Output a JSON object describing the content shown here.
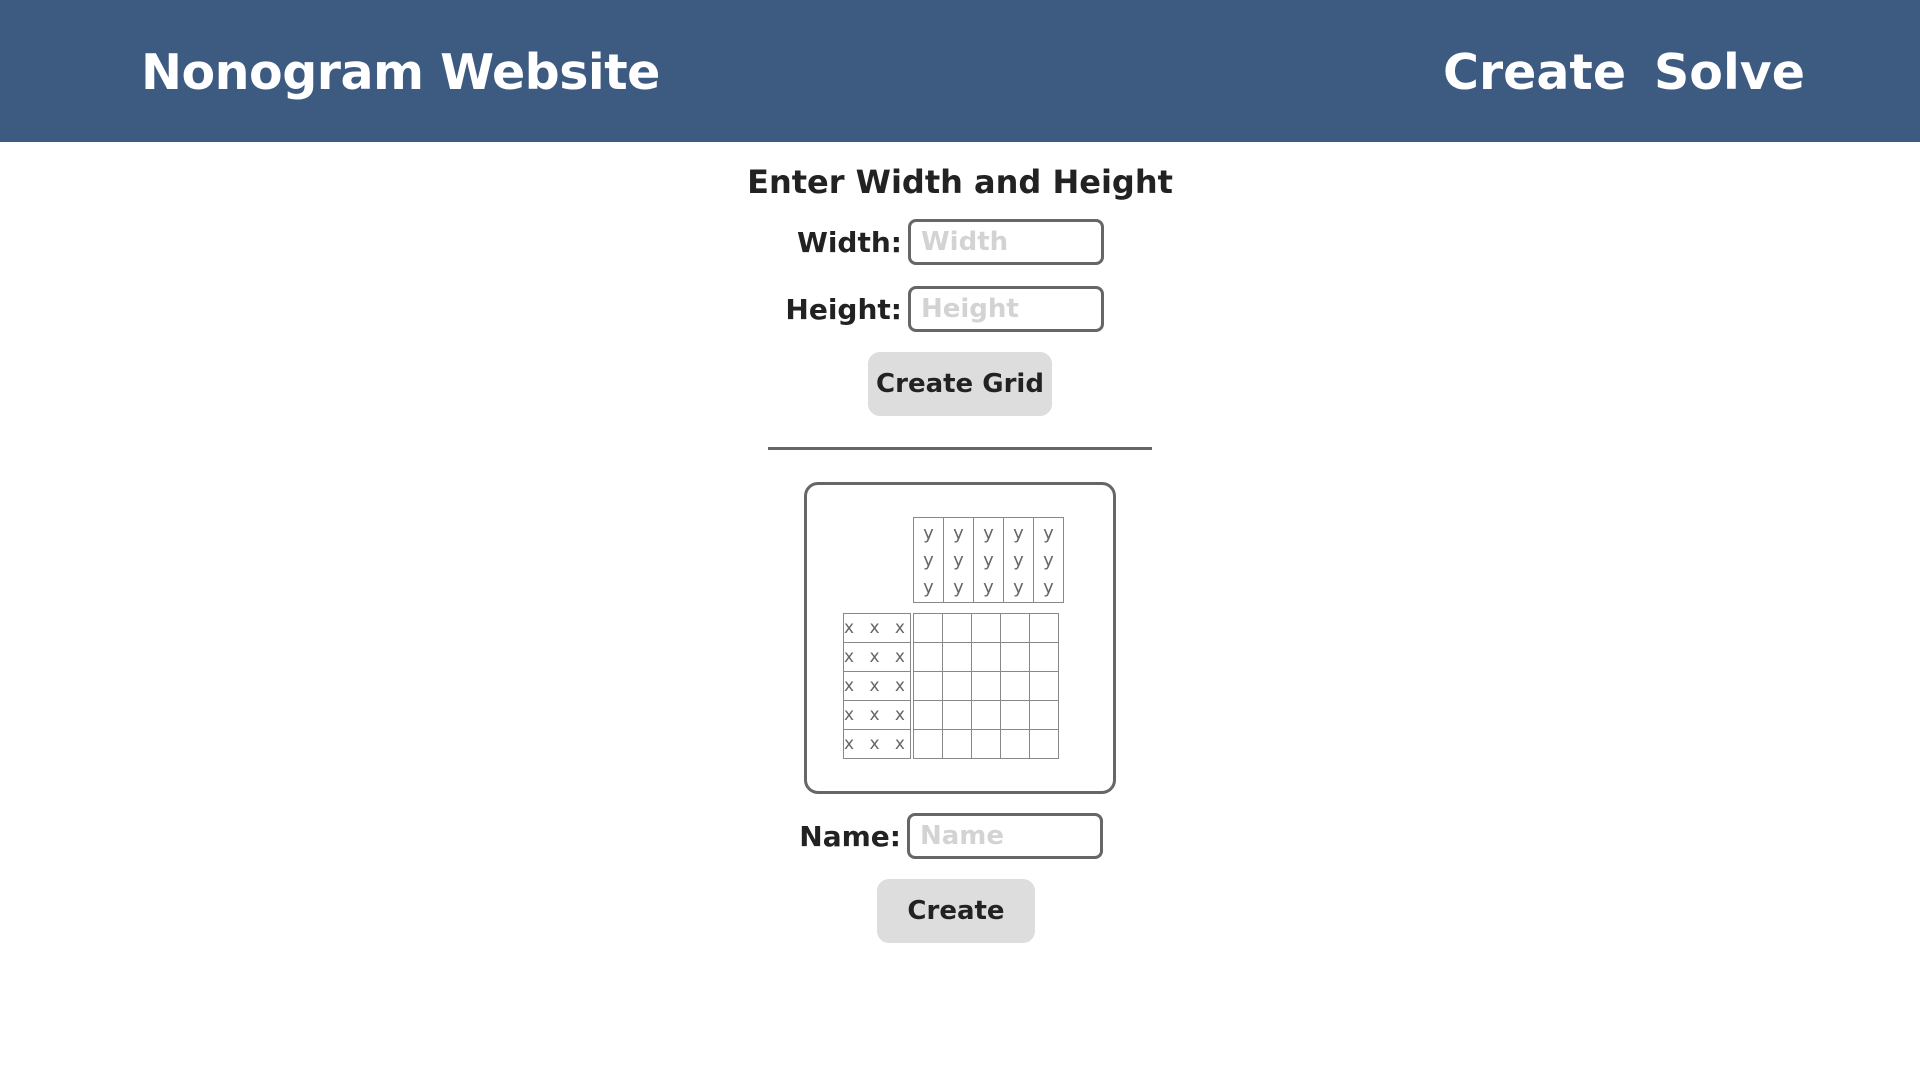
{
  "navbar": {
    "brand": "Nonogram Website",
    "links": [
      {
        "label": "Create"
      },
      {
        "label": "Solve"
      }
    ]
  },
  "size_form": {
    "title": "Enter Width and Height",
    "width_label": "Width:",
    "width_placeholder": "Width",
    "width_value": "",
    "height_label": "Height:",
    "height_placeholder": "Height",
    "height_value": "",
    "submit_label": "Create Grid"
  },
  "grid": {
    "columns": 5,
    "rows": 5,
    "column_clues": [
      "y\ny\ny",
      "y\ny\ny",
      "y\ny\ny",
      "y\ny\ny",
      "y\ny\ny"
    ],
    "row_clues": [
      "x x x",
      "x x x",
      "x x x",
      "x x x",
      "x x x"
    ]
  },
  "name_form": {
    "name_label": "Name:",
    "name_placeholder": "Name",
    "name_value": "",
    "submit_label": "Create"
  },
  "colors": {
    "navbar": "#3d5a80",
    "button": "#dddddd",
    "border": "#666666"
  }
}
